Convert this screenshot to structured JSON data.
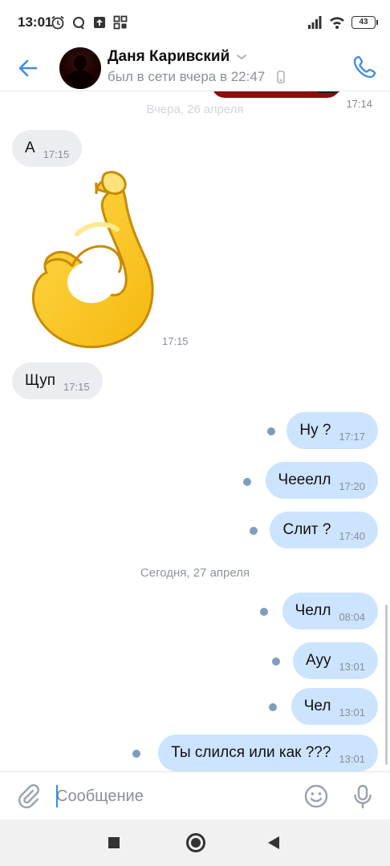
{
  "status_bar": {
    "time": "13:01",
    "battery": "43",
    "left_icons": [
      "alarm-icon",
      "sync-icon",
      "upload-icon",
      "apps-icon"
    ],
    "right_icons": [
      "signal-icon",
      "wifi-icon",
      "battery-icon"
    ]
  },
  "header": {
    "contact_name": "Даня Каривский",
    "status": "был в сети вчера в 22:47",
    "back_icon": "back-arrow-icon",
    "call_icon": "phone-icon",
    "accent": "#3f8ae0"
  },
  "chat": {
    "previous_message_time": "17:14",
    "date_yesterday": "Вчера, 26 апреля",
    "date_today": "Сегодня, 27 апреля",
    "sticker": {
      "emoji_name": "ok-hand-sticker",
      "time": "17:15"
    },
    "incoming": [
      {
        "text": "А",
        "time": "17:15"
      },
      {
        "text": "Щуп",
        "time": "17:15"
      }
    ],
    "outgoing_yesterday": [
      {
        "text": "Ну ?",
        "time": "17:17"
      },
      {
        "text": "Чееелл",
        "time": "17:20"
      },
      {
        "text": "Слит ?",
        "time": "17:40"
      }
    ],
    "outgoing_today": [
      {
        "text": "Челл",
        "time": "08:04"
      },
      {
        "text": "Ауу",
        "time": "13:01"
      },
      {
        "text": "Чел",
        "time": "13:01"
      },
      {
        "text": "Ты слился или как ???",
        "time": "13:01"
      }
    ],
    "colors": {
      "incoming_bubble": "#ebedf0",
      "outgoing_bubble": "#cce4ff",
      "unread_dot": "#7f9cbf"
    }
  },
  "composer": {
    "placeholder": "Сообщение",
    "value": "",
    "attach_icon": "paperclip-icon",
    "emoji_icon": "smile-icon",
    "mic_icon": "microphone-icon"
  },
  "navbar": {
    "buttons": [
      "recents-button",
      "home-button",
      "back-button"
    ]
  }
}
